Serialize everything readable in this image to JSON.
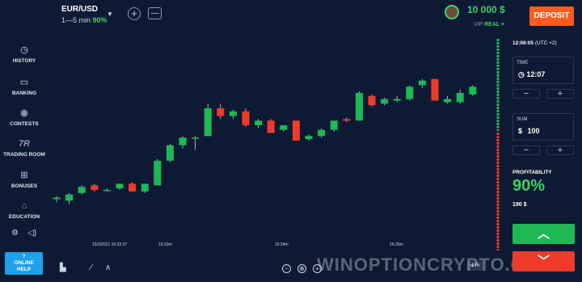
{
  "header": {
    "asset": "EUR/USD",
    "expiry": "1—5 min",
    "payout_pct": "90%",
    "balance": "10 000 $",
    "account_prefix": "VIP",
    "account_type": "REAL",
    "deposit_label": "DEPOSIT"
  },
  "sidebar": {
    "items": [
      {
        "label": "HISTORY",
        "icon": "history-icon"
      },
      {
        "label": "BANKING",
        "icon": "wallet-icon"
      },
      {
        "label": "CONTESTS",
        "icon": "trophy-icon"
      },
      {
        "label": "TRADING ROOM",
        "icon": "tr-logo-icon"
      },
      {
        "label": "BONUSES",
        "icon": "gift-icon"
      },
      {
        "label": "EDUCATION",
        "icon": "graduation-cap-icon"
      }
    ],
    "help_label_1": "?",
    "help_label_2": "ONLINE",
    "help_label_3": "HELP"
  },
  "chart": {
    "time_labels": [
      "15/3/2021 16:22:37",
      "16:23m",
      "16:24m",
      "16:25m"
    ],
    "timeframe": "1 m",
    "watermark": "WINOPTIONCRYPTO.COM",
    "up_color": "#1eb954",
    "down_color": "#ef3b2b"
  },
  "chart_data": {
    "type": "candlestick",
    "candles": [
      {
        "o": 5,
        "c": 6,
        "h": 7,
        "l": 3
      },
      {
        "o": 4,
        "c": 8,
        "h": 9,
        "l": 2
      },
      {
        "o": 9,
        "c": 13,
        "h": 14,
        "l": 8
      },
      {
        "o": 14,
        "c": 11,
        "h": 15,
        "l": 10
      },
      {
        "o": 11,
        "c": 11,
        "h": 12,
        "l": 10
      },
      {
        "o": 12,
        "c": 15,
        "h": 15,
        "l": 11
      },
      {
        "o": 15,
        "c": 10,
        "h": 16,
        "l": 10
      },
      {
        "o": 10,
        "c": 15,
        "h": 15,
        "l": 9
      },
      {
        "o": 14,
        "c": 30,
        "h": 31,
        "l": 14
      },
      {
        "o": 30,
        "c": 40,
        "h": 41,
        "l": 29
      },
      {
        "o": 40,
        "c": 45,
        "h": 46,
        "l": 38
      },
      {
        "o": 45,
        "c": 45,
        "h": 46,
        "l": 37
      },
      {
        "o": 46,
        "c": 64,
        "h": 67,
        "l": 46
      },
      {
        "o": 64,
        "c": 59,
        "h": 67,
        "l": 57
      },
      {
        "o": 59,
        "c": 62,
        "h": 63,
        "l": 57
      },
      {
        "o": 62,
        "c": 53,
        "h": 64,
        "l": 52
      },
      {
        "o": 53,
        "c": 56,
        "h": 57,
        "l": 51
      },
      {
        "o": 56,
        "c": 48,
        "h": 57,
        "l": 48
      },
      {
        "o": 50,
        "c": 53,
        "h": 53,
        "l": 49
      },
      {
        "o": 56,
        "c": 43,
        "h": 56,
        "l": 43
      },
      {
        "o": 44,
        "c": 46,
        "h": 47,
        "l": 43
      },
      {
        "o": 46,
        "c": 50,
        "h": 51,
        "l": 45
      },
      {
        "o": 50,
        "c": 56,
        "h": 56,
        "l": 49
      },
      {
        "o": 57,
        "c": 56,
        "h": 58,
        "l": 55
      },
      {
        "o": 56,
        "c": 74,
        "h": 75,
        "l": 56
      },
      {
        "o": 72,
        "c": 66,
        "h": 73,
        "l": 65
      },
      {
        "o": 67,
        "c": 70,
        "h": 71,
        "l": 66
      },
      {
        "o": 69,
        "c": 70,
        "h": 72,
        "l": 68
      },
      {
        "o": 70,
        "c": 78,
        "h": 79,
        "l": 69
      },
      {
        "o": 79,
        "c": 82,
        "h": 83,
        "l": 77
      },
      {
        "o": 83,
        "c": 69,
        "h": 83,
        "l": 69
      },
      {
        "o": 68,
        "c": 70,
        "h": 72,
        "l": 67
      },
      {
        "o": 68,
        "c": 74,
        "h": 76,
        "l": 67
      },
      {
        "o": 73,
        "c": 78,
        "h": 79,
        "l": 72
      }
    ]
  },
  "panel": {
    "server_time": "12:06:05",
    "timezone": "(UTC +2)",
    "time_label": "TIME",
    "time_value": "12:07",
    "sum_label": "SUM",
    "sum_currency": "$",
    "sum_value": "100",
    "minus": "−",
    "plus": "+",
    "profit_label": "PROFITABILITY",
    "profit_value": "90%",
    "payout_value": "190 $"
  }
}
